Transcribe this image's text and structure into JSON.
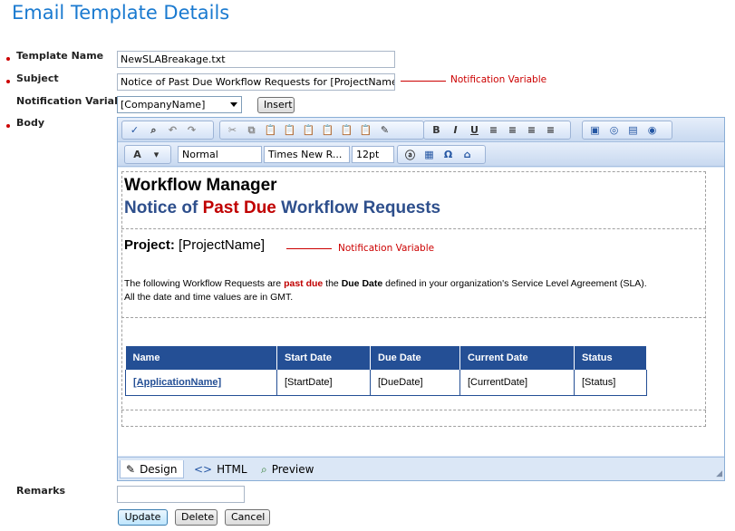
{
  "page": {
    "title": "Email Template Details"
  },
  "form": {
    "template_name": {
      "label": "Template Name",
      "value": "NewSLABreakage.txt"
    },
    "subject": {
      "label": "Subject",
      "value": "Notice of Past Due Workflow Requests  for [ProjectName]"
    },
    "notification_variable": {
      "label": "Notification Variable",
      "selected": "[CompanyName]",
      "insert_label": "Insert"
    },
    "body": {
      "label": "Body"
    },
    "remarks": {
      "label": "Remarks",
      "value": ""
    }
  },
  "annotations": {
    "subject_note": "Notification Variable",
    "project_note": "Notification Variable"
  },
  "editor": {
    "toolbar2": {
      "paragraph_style": "Normal",
      "font_name": "Times New R...",
      "font_size": "12pt"
    },
    "content": {
      "heading": "Workflow Manager",
      "subheading_pre": "Notice of ",
      "subheading_red": "Past Due",
      "subheading_post": " Workflow Requests",
      "project_label": "Project:",
      "project_value": " [ProjectName]",
      "desc_1": "The following Workflow Requests are ",
      "desc_pd": "past due",
      "desc_2": " the ",
      "desc_dd": "Due Date",
      "desc_3": " defined in your organization's Service Level Agreement (SLA).",
      "desc_line2": "All the date and time values are in GMT.",
      "table": {
        "headers": [
          "Name",
          "Start Date",
          "Due Date",
          "Current Date",
          "Status"
        ],
        "row": [
          "[ApplicationName]",
          "[StartDate]",
          "[DueDate]",
          "[CurrentDate]",
          "[Status]"
        ]
      }
    },
    "tabs": {
      "design": "Design",
      "html": "HTML",
      "preview": "Preview"
    }
  },
  "actions": {
    "update": "Update",
    "delete": "Delete",
    "cancel": "Cancel"
  },
  "colors": {
    "title": "#1a7ad0",
    "required_bullet": "#cc0000",
    "table_header": "#244f95",
    "annotation": "#cc0000"
  }
}
